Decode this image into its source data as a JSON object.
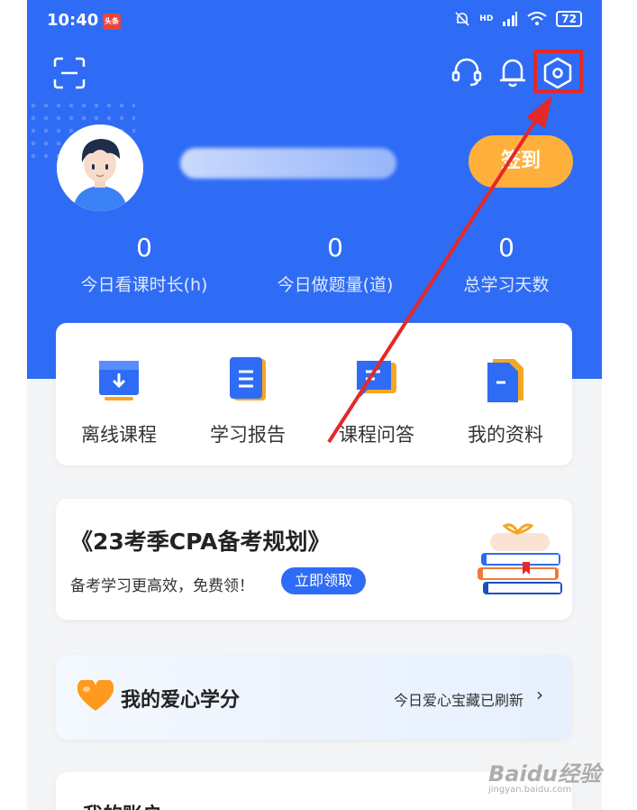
{
  "status_bar": {
    "time": "10:40",
    "app_badge": "头条",
    "network": "HD",
    "battery": "72"
  },
  "profile": {
    "checkin_label": "签到"
  },
  "stats": [
    {
      "value": "0",
      "label": "今日看课时长(h)"
    },
    {
      "value": "0",
      "label": "今日做题量(道)"
    },
    {
      "value": "0",
      "label": "总学习天数"
    }
  ],
  "quick_actions": [
    {
      "label": "离线课程",
      "icon": "download-folder-icon"
    },
    {
      "label": "学习报告",
      "icon": "report-icon"
    },
    {
      "label": "课程问答",
      "icon": "qa-chat-icon"
    },
    {
      "label": "我的资料",
      "icon": "document-icon"
    }
  ],
  "promo": {
    "title": "《23考季CPA备考规划》",
    "subtitle": "备考学习更高效，免费领！",
    "button": "立即领取"
  },
  "love_credits": {
    "title": "我的爱心学分",
    "status": "今日爱心宝藏已刷新",
    "chevron": "›"
  },
  "bottom_section": {
    "title": "我的账户"
  },
  "watermark": {
    "text": "Baidu经验",
    "url": "jingyan.baidu.com"
  },
  "colors": {
    "primary": "#2f6cf5",
    "checkin": "#ffb03c",
    "annotation": "#e52828",
    "heart": "#ff9a1f"
  }
}
